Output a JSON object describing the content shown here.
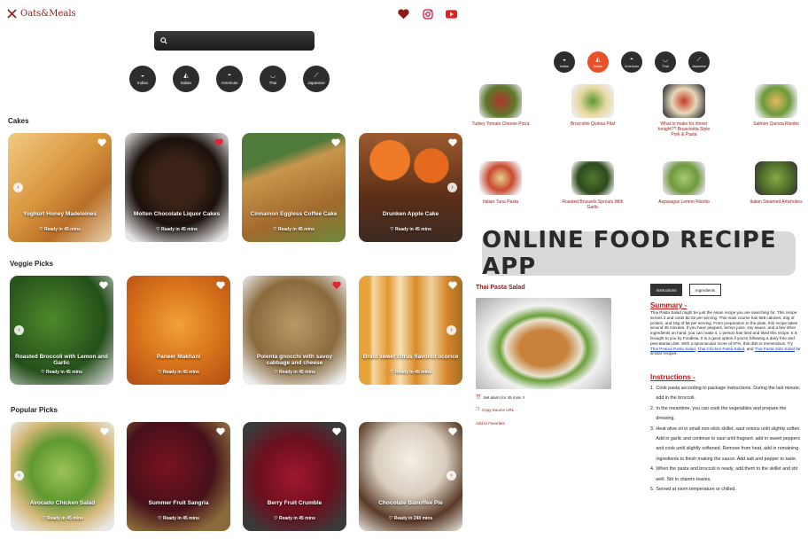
{
  "app": {
    "name": "Oats&Meals"
  },
  "search": {
    "placeholder": ""
  },
  "cuisines": [
    "Indian",
    "Italian",
    "American",
    "Thai",
    "Japanese"
  ],
  "sections": {
    "cakes": {
      "title": "Cakes",
      "cards": [
        {
          "title": "Yoghurt Honey Madeleines",
          "ready": "Ready in 45 mins",
          "liked": false
        },
        {
          "title": "Molten Chocolate Liquor Cakes",
          "ready": "Ready in 45 mins",
          "liked": true
        },
        {
          "title": "Cinnamon Eggless Coffee Cake",
          "ready": "Ready in 45 mins",
          "liked": false
        },
        {
          "title": "Drunken Apple Cake",
          "ready": "Ready in 45 mins",
          "liked": false
        }
      ]
    },
    "veggie": {
      "title": "Veggie Picks",
      "cards": [
        {
          "title": "Roasted Broccoli with Lemon and Garlic",
          "ready": "Ready in 45 mins",
          "liked": false
        },
        {
          "title": "Paneer Makhani",
          "ready": "Ready in 45 mins",
          "liked": false
        },
        {
          "title": "Polenta gnocchi with savoy cabbage and cheese",
          "ready": "Ready in 45 mins",
          "liked": true
        },
        {
          "title": "Braid sweet citrus flavored licorice",
          "ready": "Ready in 45 mins",
          "liked": false
        }
      ]
    },
    "popular": {
      "title": "Popular Picks",
      "cards": [
        {
          "title": "Avocado Chicken Salad",
          "ready": "Ready in 45 mins",
          "liked": false
        },
        {
          "title": "Summer Fruit Sangria",
          "ready": "Ready in 45 mins",
          "liked": false
        },
        {
          "title": "Berry Fruit Crumble",
          "ready": "Ready in 45 mins",
          "liked": false
        },
        {
          "title": "Chocolate Banoffee Pie",
          "ready": "Ready in 240 mins",
          "liked": false
        }
      ]
    }
  },
  "grid": [
    {
      "title": "Turkey Tomato Cheese Pizza"
    },
    {
      "title": "Broccolini Quinoa Pilaf"
    },
    {
      "title": "What to make for dinner tonight?? Bruschetta Style Pork & Pasta"
    },
    {
      "title": "Salmon Quinoa Risotto"
    },
    {
      "title": "Italian Tuna Pasta"
    },
    {
      "title": "Roasted Brussels Sprouts With Garlic"
    },
    {
      "title": "Asparagus Lemon Risotto"
    },
    {
      "title": "Italian Steamed Artichokes"
    }
  ],
  "banner": "ONLINE FOOD RECIPE APP",
  "detail": {
    "title": "Thai Pasta Salad",
    "alarm": "Set alarm for 45 mins !!",
    "copy": "Copy Source URL",
    "favorite": "Add to Favorites",
    "tabs": [
      "Instructions",
      "Ingredients"
    ],
    "summary_heading": "Summary -",
    "summary_text": "Thai Pasta Salad might be just the Asian recipe you are searching for. This recipe serves 2 and costs $2.02 per serving. This main course has 558 calories, 20g of protein, and 16g of fat per serving. From preparation to the plate, this recipe takes around 45 minutes. If you have peppers, lemon juice, soy sauce, and a few other ingredients on hand, you can make it. 1 person has tried and liked this recipe. It is brought to you by Foodista. It is a good option if you're following a dairy free and pescetarian diet. With a spoonacular score of 97%, this dish is tremendous. Try",
    "summary_link1": "Thai Peanut Pasta Salad",
    "summary_link2": "Thai Chicken Pasta Salad",
    "summary_and": ", and",
    "summary_link3": "Thai Pasta Side Salad",
    "summary_tail": "for similar recipes.",
    "instructions_heading": "Instructions -",
    "steps": [
      "Cook pasta according to package instructions. During the last minute, add in the broccoli.",
      "In the meantime, you can cook the vegetables and prepare the dressing.",
      "Heat olive oil in small non-stick skillet, saut onions until slightly soften. Add in garlic and continue to saut until fragrant. add in sweet peppers and cook until slightly softened. Remove from heat, add in remaining ingredients to finish making the sauce. Add salt and pepper to taste.",
      "When the pasta and broccoli is ready, add them to the skillet and stir well. Stir in cilantro leaves.",
      "Served at room temperature or chilled."
    ]
  },
  "colors": {
    "brand": "#8b1a1a",
    "accent": "#e8502a",
    "dark": "#2d2d2d"
  }
}
